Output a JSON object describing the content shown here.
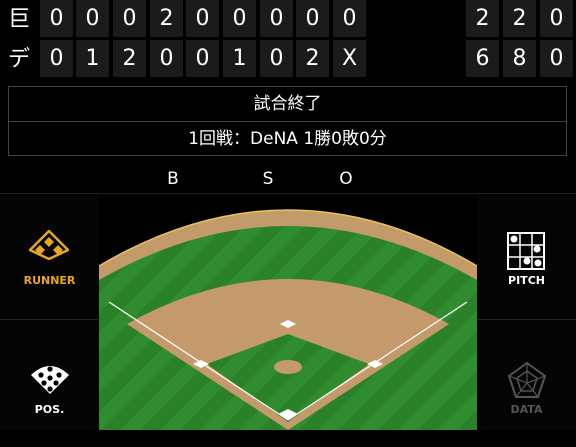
{
  "scoreboard": {
    "away": {
      "name": "巨",
      "innings": [
        "0",
        "0",
        "0",
        "2",
        "0",
        "0",
        "0",
        "0",
        "0"
      ],
      "totals": [
        "2",
        "2",
        "0"
      ]
    },
    "home": {
      "name": "デ",
      "innings": [
        "0",
        "1",
        "2",
        "0",
        "0",
        "1",
        "0",
        "2",
        "X"
      ],
      "totals": [
        "6",
        "8",
        "0"
      ]
    }
  },
  "status": {
    "game_state": "試合終了",
    "series_record": "1回戦：DeNA 1勝0敗0分"
  },
  "count": {
    "ball_label": "B",
    "strike_label": "S",
    "out_label": "O"
  },
  "panels": {
    "runner_label": "RUNNER",
    "position_label": "POS.",
    "pitch_label": "PITCH",
    "data_label": "DATA"
  },
  "colors": {
    "active_accent": "#e6a71e",
    "inactive_gray": "#555555",
    "field_green": "#2e8a2e",
    "dirt": "#c49a6c",
    "warning_track": "#b08a5b"
  }
}
